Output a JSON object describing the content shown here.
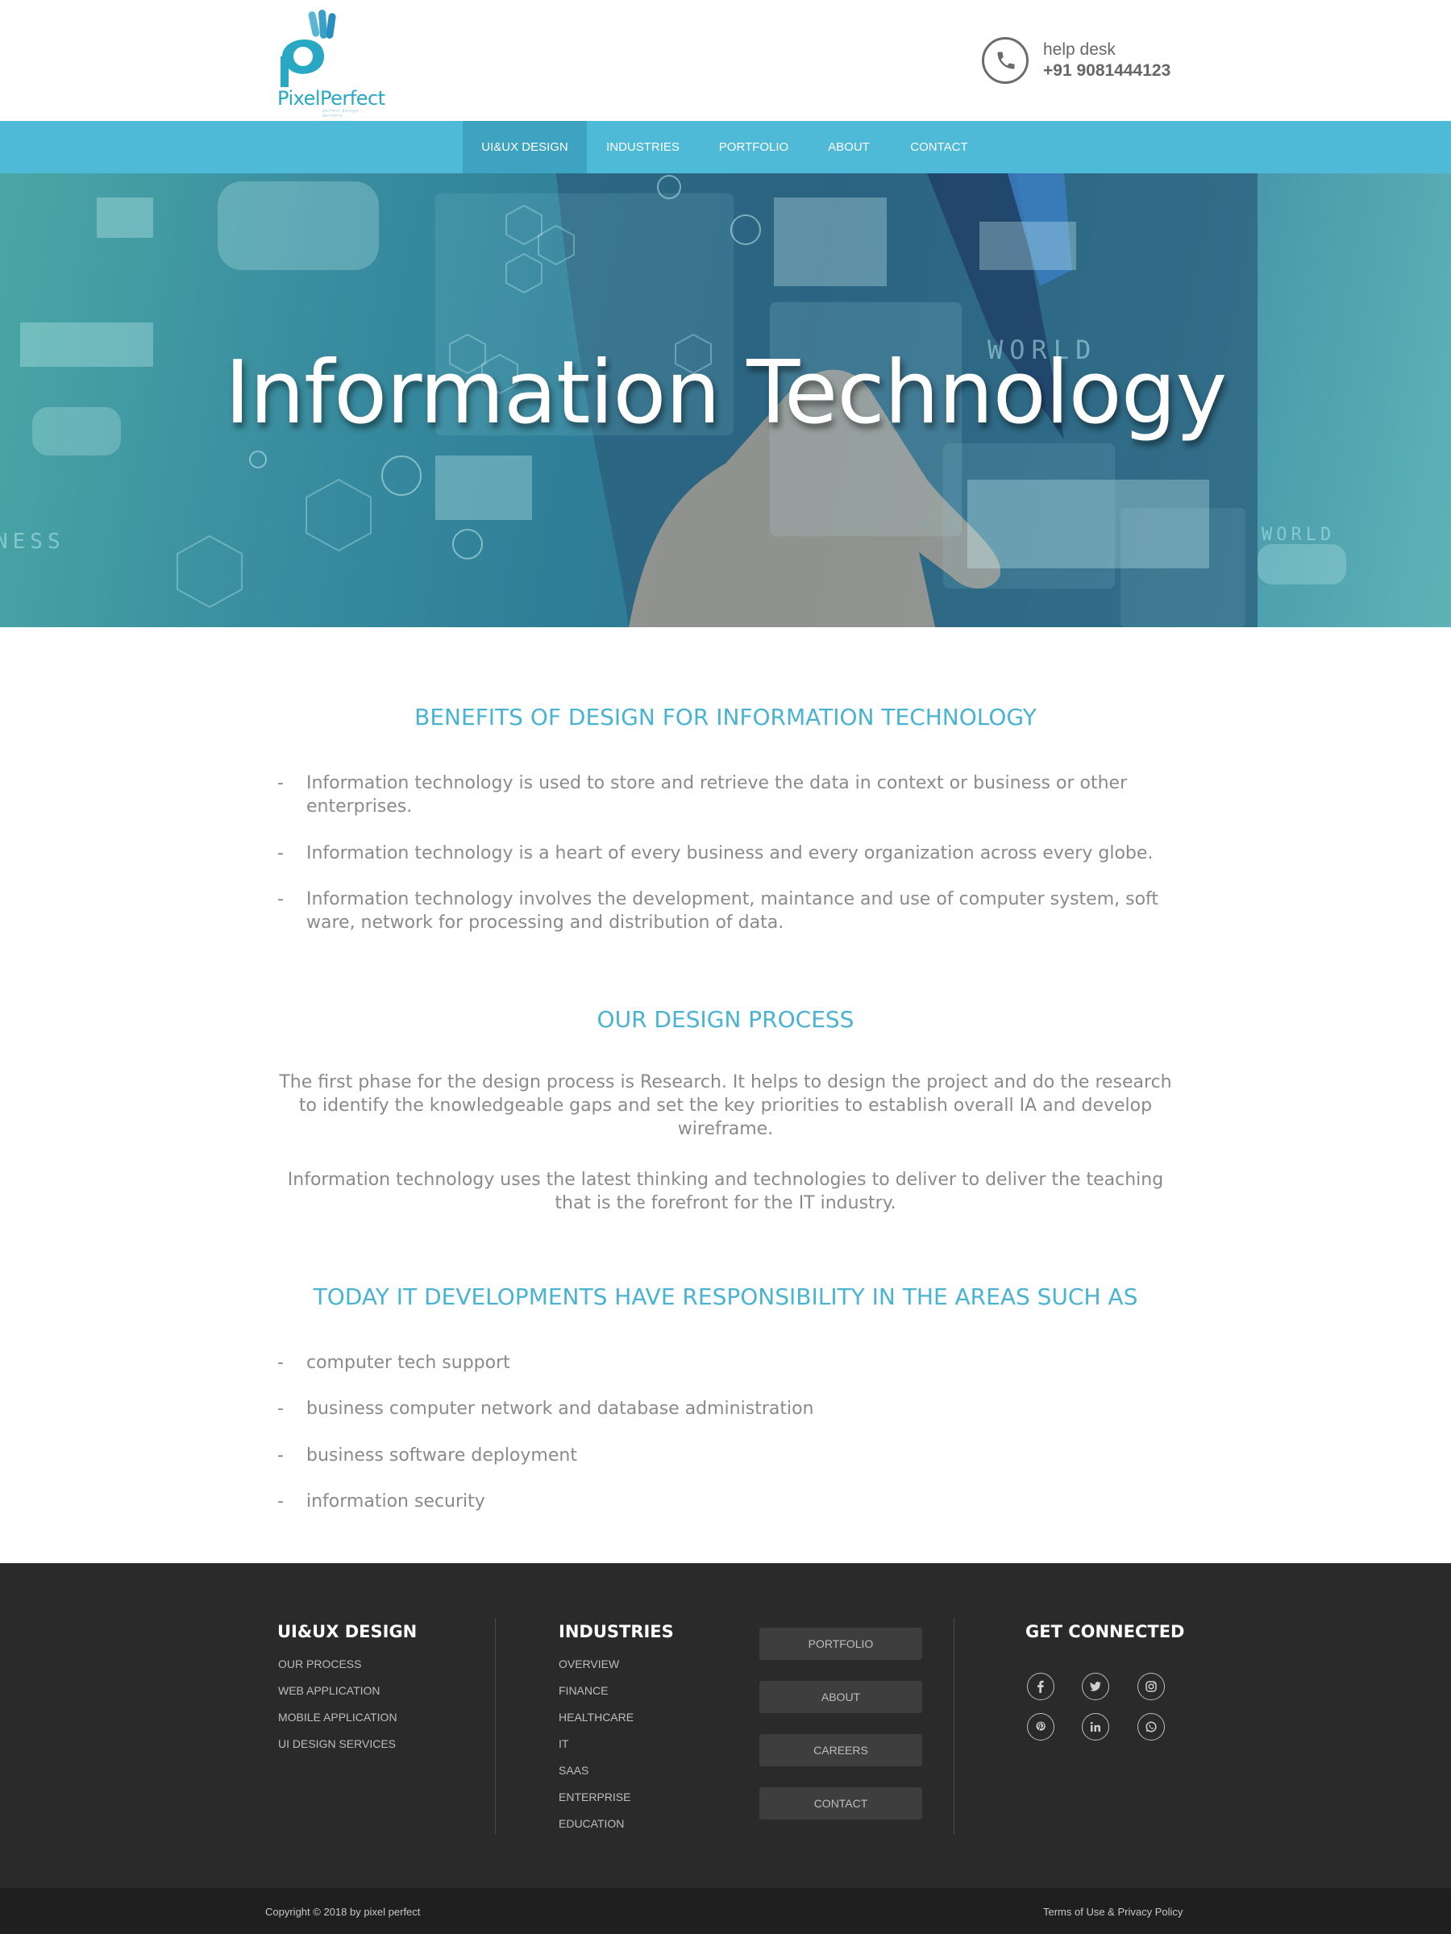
{
  "brand": {
    "logo_text": "PixelPerfect",
    "logo_tagline": "perfect design .. delivery",
    "accent": "#4fbad8"
  },
  "helpdesk": {
    "icon": "phone-icon",
    "label": "help desk",
    "number": "+91 9081444123"
  },
  "nav": {
    "items": [
      {
        "label": "UI&UX DESIGN",
        "active": true
      },
      {
        "label": "INDUSTRIES",
        "active": false
      },
      {
        "label": "PORTFOLIO",
        "active": false
      },
      {
        "label": "ABOUT",
        "active": false
      },
      {
        "label": "CONTACT",
        "active": false
      }
    ]
  },
  "hero": {
    "title": "Information Technology"
  },
  "benefits": {
    "title": "BENEFITS OF DESIGN FOR INFORMATION TECHNOLOGY",
    "items": [
      {
        "dash": "-",
        "text": "Information technology is used to store and retrieve the data in context or business or other enterprises."
      },
      {
        "dash": "-",
        "text": "Information technology is a heart of every business and every organization across every globe."
      },
      {
        "dash": "-",
        "text": "Information technology involves the development, maintance and use of computer system, soft ware, network for processing and distribution of data."
      }
    ]
  },
  "process": {
    "title": "OUR DESIGN PROCESS",
    "paragraphs": [
      "The first phase for the design process is Research. It helps to design the project and do the research to identify the knowledgeable gaps and set the key priorities to establish overall IA and develop wireframe.",
      "Information technology uses the latest thinking and technologies to deliver to deliver the teaching that is the forefront for the IT industry."
    ]
  },
  "areas": {
    "title": "TODAY IT DEVELOPMENTS HAVE RESPONSIBILITY IN THE AREAS SUCH AS",
    "items": [
      {
        "dash": "-",
        "text": "computer tech support"
      },
      {
        "dash": "-",
        "text": "business computer network and database administration"
      },
      {
        "dash": "-",
        "text": "business software deployment"
      },
      {
        "dash": "-",
        "text": "information security"
      }
    ]
  },
  "footer": {
    "design": {
      "title": "UI&UX DESIGN",
      "links": [
        "OUR PROCESS",
        "WEB APPLICATION",
        "MOBILE APPLICATION",
        "UI DESIGN SERVICES"
      ]
    },
    "industries": {
      "title": "INDUSTRIES",
      "links": [
        "OVERVIEW",
        "FINANCE",
        "HEALTHCARE",
        "IT",
        "SAAS",
        "ENTERPRISE",
        "EDUCATION"
      ]
    },
    "buttons": [
      "PORTFOLIO",
      "ABOUT",
      "CAREERS",
      "CONTACT"
    ],
    "connect": {
      "title": "GET CONNECTED",
      "icons": [
        "facebook-icon",
        "twitter-icon",
        "instagram-icon",
        "pinterest-icon",
        "linkedin-icon",
        "whatsapp-icon"
      ]
    },
    "copyright": "Copyright © 2018 by pixel perfect",
    "terms": "Terms of Use & Privacy Policy"
  }
}
